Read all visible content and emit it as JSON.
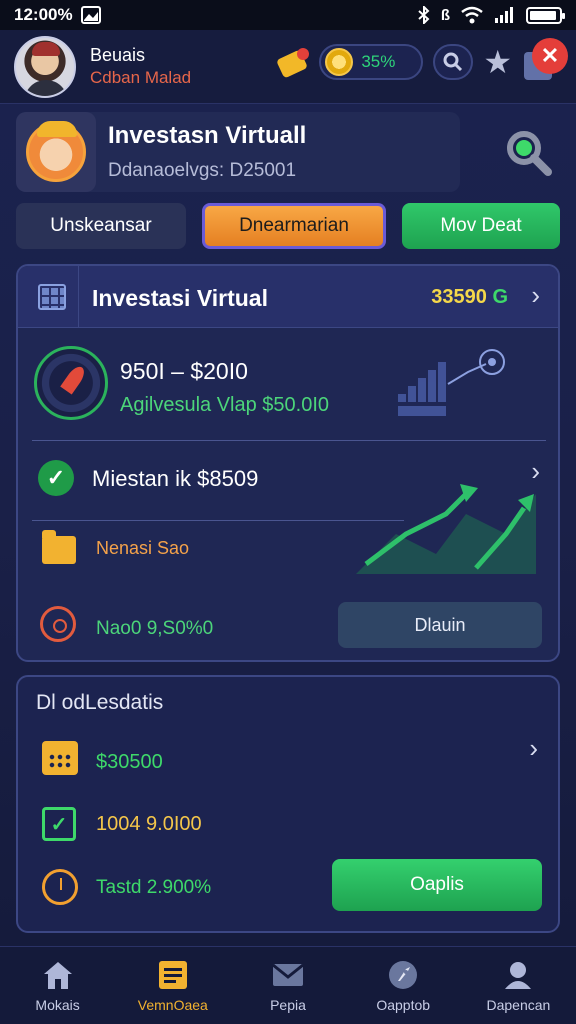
{
  "status_bar": {
    "time": "12:00%",
    "signal_text": "ß"
  },
  "header": {
    "user_name": "Beuais",
    "user_sub": "Cdban Malad",
    "coin_value": "35%"
  },
  "profile_card": {
    "title": "Investasn Virtuall",
    "subtitle": "Ddanaoelvgs: D25001"
  },
  "tabs": [
    {
      "label": "Unskeansar"
    },
    {
      "label": "Dnearmarian"
    },
    {
      "label": "Mov Deat"
    }
  ],
  "panel_a": {
    "title": "Investasi Virtual",
    "value_main": "33590",
    "value_suffix": "G",
    "range": "950Ι – $20Ι0",
    "range_sub": "Agilvesula Vlap $50.0Ι0",
    "milestone": "Miestan ik $8509",
    "folder_text": "Nenasi Sao",
    "target_text": "Nao0 9,S0%0",
    "button": "Dlauin"
  },
  "panel_b": {
    "title": "Dl odLesdatis",
    "val_1": "$30500",
    "val_2": "1004 9.0Ι00",
    "val_3": "Tastd 2.900%",
    "button": "Oaplis"
  },
  "bottom_nav": [
    {
      "label": "Mokais",
      "icon": "home-icon"
    },
    {
      "label": "VemnOaea",
      "icon": "document-icon"
    },
    {
      "label": "Pepia",
      "icon": "mail-icon"
    },
    {
      "label": "Oapptob",
      "icon": "rocket-icon"
    },
    {
      "label": "Dapencan",
      "icon": "profile-icon"
    }
  ],
  "colors": {
    "accent_orange": "#f8a845",
    "accent_green": "#30c86a",
    "close_red": "#e43e3a"
  }
}
